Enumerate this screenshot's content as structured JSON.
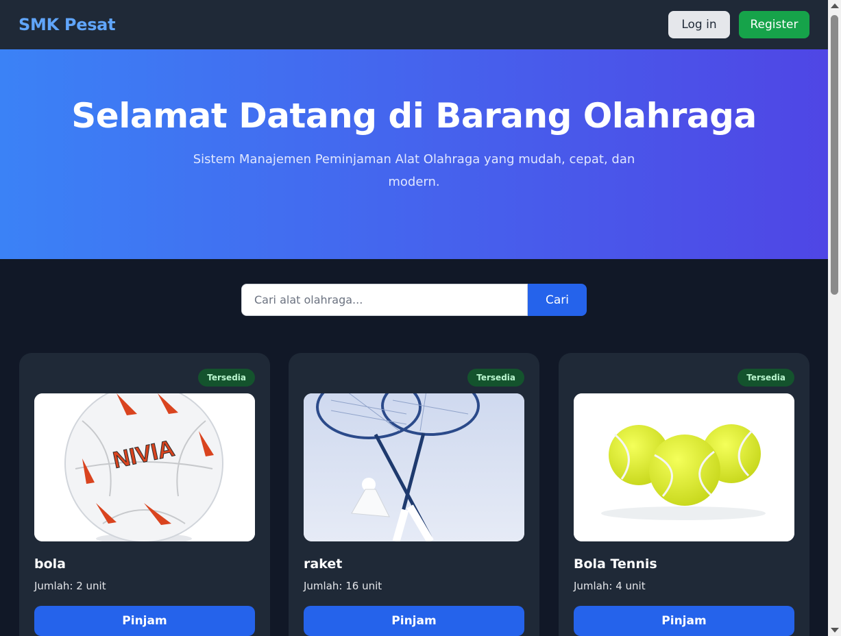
{
  "navbar": {
    "brand": "SMK Pesat",
    "login_label": "Log in",
    "register_label": "Register"
  },
  "hero": {
    "title": "Selamat Datang di Barang Olahraga",
    "subtitle": "Sistem Manajemen Peminjaman Alat Olahraga yang mudah, cepat, dan modern."
  },
  "search": {
    "placeholder": "Cari alat olahraga...",
    "value": "",
    "button_label": "Cari"
  },
  "items": [
    {
      "name": "bola",
      "quantity": "Jumlah: 2 unit",
      "status": "Tersedia",
      "button_label": "Pinjam",
      "image": "football-image"
    },
    {
      "name": "raket",
      "quantity": "Jumlah: 16 unit",
      "status": "Tersedia",
      "button_label": "Pinjam",
      "image": "badminton-racket-image"
    },
    {
      "name": "Bola Tennis",
      "quantity": "Jumlah: 4 unit",
      "status": "Tersedia",
      "button_label": "Pinjam",
      "image": "tennis-balls-image"
    }
  ],
  "colors": {
    "brand": "#60a5fa",
    "hero_gradient_start": "#3b82f6",
    "hero_gradient_end": "#4f46e5",
    "primary_button": "#2563eb",
    "register_button": "#16a34a",
    "badge_bg": "#14532d",
    "page_bg": "#111827",
    "card_bg": "#1f2937"
  }
}
